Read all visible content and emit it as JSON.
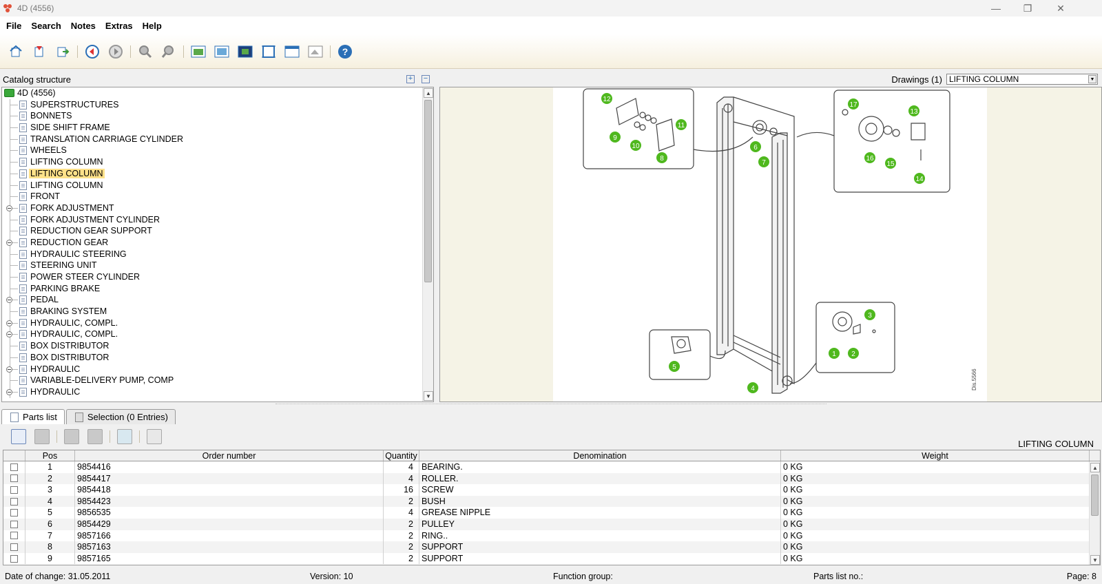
{
  "window": {
    "title": "4D (4556)"
  },
  "menu": [
    "File",
    "Search",
    "Notes",
    "Extras",
    "Help"
  ],
  "toolbar": {
    "icons": [
      "home-icon",
      "bookmark-icon",
      "export-icon",
      "back-icon",
      "forward-icon",
      "zoom-in-icon",
      "zoom-out-icon",
      "image-view-icon",
      "image-view-2-icon",
      "image-fullscreen-icon",
      "fit-frame-icon",
      "window-icon",
      "picture-export-icon",
      "help-icon"
    ]
  },
  "catalog": {
    "header": "Catalog structure",
    "root": "4D (4556)",
    "items": [
      {
        "label": "SUPERSTRUCTURES",
        "expandable": false,
        "selected": false
      },
      {
        "label": "BONNETS",
        "expandable": false,
        "selected": false
      },
      {
        "label": "SIDE SHIFT FRAME",
        "expandable": false,
        "selected": false
      },
      {
        "label": "TRANSLATION CARRIAGE CYLINDER",
        "expandable": false,
        "selected": false
      },
      {
        "label": "WHEELS",
        "expandable": false,
        "selected": false
      },
      {
        "label": "LIFTING COLUMN",
        "expandable": false,
        "selected": false
      },
      {
        "label": "LIFTING COLUMN",
        "expandable": false,
        "selected": true
      },
      {
        "label": "LIFTING COLUMN",
        "expandable": false,
        "selected": false
      },
      {
        "label": "FRONT",
        "expandable": false,
        "selected": false
      },
      {
        "label": "FORK ADJUSTMENT",
        "expandable": true,
        "selected": false
      },
      {
        "label": "FORK ADJUSTMENT CYLINDER",
        "expandable": false,
        "selected": false
      },
      {
        "label": "REDUCTION GEAR SUPPORT",
        "expandable": false,
        "selected": false
      },
      {
        "label": "REDUCTION GEAR",
        "expandable": true,
        "selected": false
      },
      {
        "label": "HYDRAULIC STEERING",
        "expandable": false,
        "selected": false
      },
      {
        "label": "STEERING UNIT",
        "expandable": false,
        "selected": false
      },
      {
        "label": "POWER STEER CYLINDER",
        "expandable": false,
        "selected": false
      },
      {
        "label": "PARKING BRAKE",
        "expandable": false,
        "selected": false
      },
      {
        "label": "PEDAL",
        "expandable": true,
        "selected": false
      },
      {
        "label": "BRAKING SYSTEM",
        "expandable": false,
        "selected": false
      },
      {
        "label": "HYDRAULIC, COMPL.",
        "expandable": true,
        "selected": false
      },
      {
        "label": "HYDRAULIC, COMPL.",
        "expandable": true,
        "selected": false
      },
      {
        "label": "BOX DISTRIBUTOR",
        "expandable": false,
        "selected": false
      },
      {
        "label": "BOX DISTRIBUTOR",
        "expandable": false,
        "selected": false
      },
      {
        "label": "HYDRAULIC",
        "expandable": true,
        "selected": false
      },
      {
        "label": "VARIABLE-DELIVERY PUMP, COMP",
        "expandable": false,
        "selected": false
      },
      {
        "label": "HYDRAULIC",
        "expandable": true,
        "selected": false
      }
    ]
  },
  "drawings": {
    "label": "Drawings (1)",
    "selected": "LIFTING COLUMN",
    "callouts": [
      "1",
      "2",
      "3",
      "4",
      "5",
      "6",
      "7",
      "8",
      "9",
      "10",
      "11",
      "12",
      "13",
      "14",
      "15",
      "16",
      "17"
    ],
    "drawing_id": "Dis.5566"
  },
  "tabs": [
    {
      "label": "Parts list",
      "active": true
    },
    {
      "label": "Selection (0 Entries)",
      "active": false
    }
  ],
  "parts": {
    "title": "LIFTING COLUMN",
    "columns": [
      "Pos",
      "Order number",
      "Quantity",
      "Denomination",
      "Weight"
    ],
    "rows": [
      {
        "pos": "1",
        "order": "9854416",
        "qty": "4",
        "den": "BEARING.",
        "wt": "0 KG"
      },
      {
        "pos": "2",
        "order": "9854417",
        "qty": "4",
        "den": "ROLLER.",
        "wt": "0 KG"
      },
      {
        "pos": "3",
        "order": "9854418",
        "qty": "16",
        "den": "SCREW",
        "wt": "0 KG"
      },
      {
        "pos": "4",
        "order": "9854423",
        "qty": "2",
        "den": "BUSH",
        "wt": "0 KG"
      },
      {
        "pos": "5",
        "order": "9856535",
        "qty": "4",
        "den": "GREASE NIPPLE",
        "wt": "0 KG"
      },
      {
        "pos": "6",
        "order": "9854429",
        "qty": "2",
        "den": "PULLEY",
        "wt": "0 KG"
      },
      {
        "pos": "7",
        "order": "9857166",
        "qty": "2",
        "den": "RING..",
        "wt": "0 KG"
      },
      {
        "pos": "8",
        "order": "9857163",
        "qty": "2",
        "den": "SUPPORT",
        "wt": "0 KG"
      },
      {
        "pos": "9",
        "order": "9857165",
        "qty": "2",
        "den": "SUPPORT",
        "wt": "0 KG"
      }
    ]
  },
  "status": {
    "date": "Date of change: 31.05.2011",
    "version": "Version: 10",
    "function_group": "Function group:",
    "parts_list_no": "Parts list no.:",
    "page": "Page: 8"
  },
  "colors": {
    "callout": "#4fb81e",
    "selection": "#ffe28a",
    "toolbar_accent": "#2b6fb6"
  }
}
